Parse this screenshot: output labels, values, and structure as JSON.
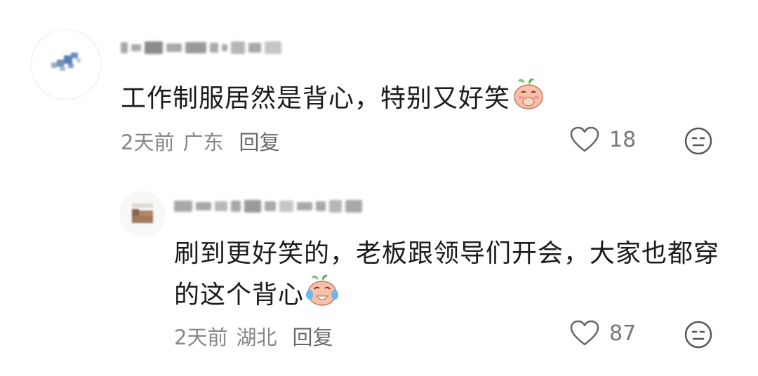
{
  "comments": [
    {
      "text": "工作制服居然是背心，特别又好笑",
      "emoji": "blush-laugh-emoji",
      "time": "2天前",
      "location": "广东",
      "reply_label": "回复",
      "likes": "18"
    },
    {
      "text": "刷到更好笑的，老板跟领导们开会，大家也都穿的这个背心",
      "emoji": "tears-of-joy-emoji",
      "time": "2天前",
      "location": "湖北",
      "reply_label": "回复",
      "likes": "87"
    }
  ],
  "icons": {
    "like": "heart-outline-icon",
    "react": "neutral-face-icon"
  },
  "colors": {
    "text": "#1b1b1b",
    "meta": "#888888",
    "emoji_skin": "#f6c1a8",
    "emoji_leaf": "#7cc36c"
  }
}
